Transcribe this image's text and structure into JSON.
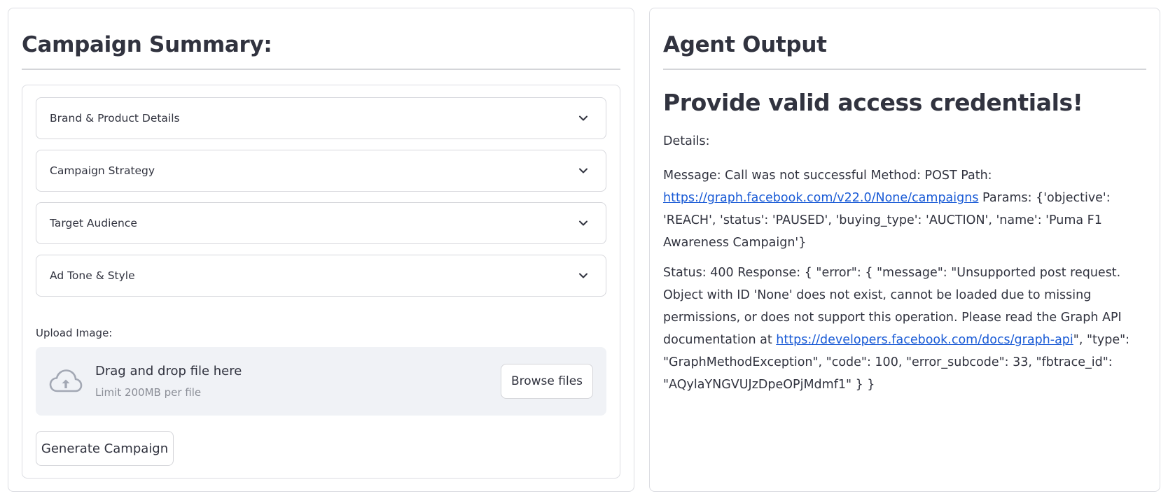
{
  "left_panel": {
    "title": "Campaign Summary:",
    "expanders": [
      {
        "label": "Brand & Product Details"
      },
      {
        "label": "Campaign Strategy"
      },
      {
        "label": "Target Audience"
      },
      {
        "label": "Ad Tone & Style"
      }
    ],
    "upload": {
      "label": "Upload Image:",
      "drop_title": "Drag and drop file here",
      "limit": "Limit 200MB per file",
      "browse_label": "Browse files"
    },
    "generate_label": "Generate Campaign"
  },
  "right_panel": {
    "title": "Agent Output",
    "error_heading": "Provide valid access credentials!",
    "details_label": "Details:",
    "message": {
      "prefix": "Message: Call was not successful Method: POST Path:",
      "link": "https://graph.facebook.com/v22.0/None/campaigns",
      "suffix": "Params: {'objective': 'REACH', 'status': 'PAUSED', 'buying_type': 'AUCTION', 'name': 'Puma F1 Awareness Campaign'}"
    },
    "status": {
      "prefix": "Status: 400 Response: { \"error\": { \"message\": \"Unsupported post request. Object with ID 'None' does not exist, cannot be loaded due to missing permissions, or does not support this operation. Please read the Graph API documentation at",
      "link": "https://developers.facebook.com/docs/graph-api",
      "suffix": "\", \"type\": \"GraphMethodException\", \"code\": 100, \"error_subcode\": 33, \"fbtrace_id\": \"AQylaYNGVUJzDpeOPjMdmf1\" } }"
    }
  },
  "colors": {
    "text": "#31333f",
    "link": "#1a5bd6",
    "dropzone_bg": "#f0f2f6",
    "border": "#dcdde2",
    "muted": "#8a8d96"
  },
  "icons": {
    "expander_chevron": "chevron-down-icon",
    "upload": "cloud-upload-icon"
  }
}
